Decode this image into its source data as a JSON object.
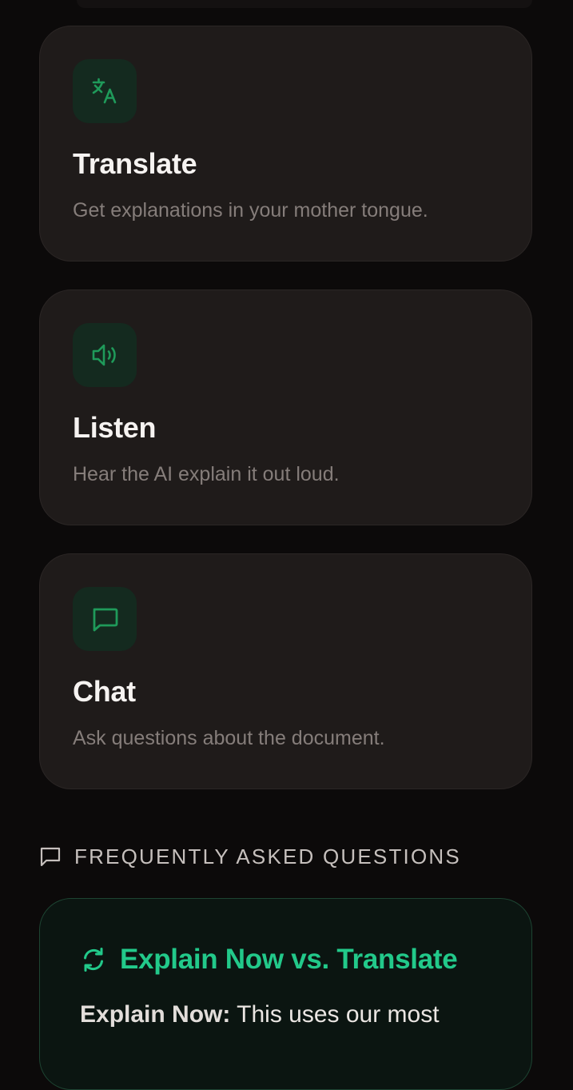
{
  "features": [
    {
      "title": "Translate",
      "description": "Get explanations in your mother tongue.",
      "icon": "translate-icon"
    },
    {
      "title": "Listen",
      "description": "Hear the AI explain it out loud.",
      "icon": "speaker-icon"
    },
    {
      "title": "Chat",
      "description": "Ask questions about the document.",
      "icon": "chat-icon"
    }
  ],
  "faq": {
    "heading": "FREQUENTLY ASKED QUESTIONS",
    "heading_icon": "message-square-icon",
    "items": [
      {
        "question": "Explain Now vs. Translate",
        "question_icon": "refresh-icon",
        "answer_lead": "Explain Now:",
        "answer_text": " This uses our most"
      }
    ]
  },
  "colors": {
    "accent": "#22c98a",
    "icon_green": "#1f9a5a",
    "card_bg": "#1f1b1a",
    "page_bg": "#0c0a0a"
  }
}
